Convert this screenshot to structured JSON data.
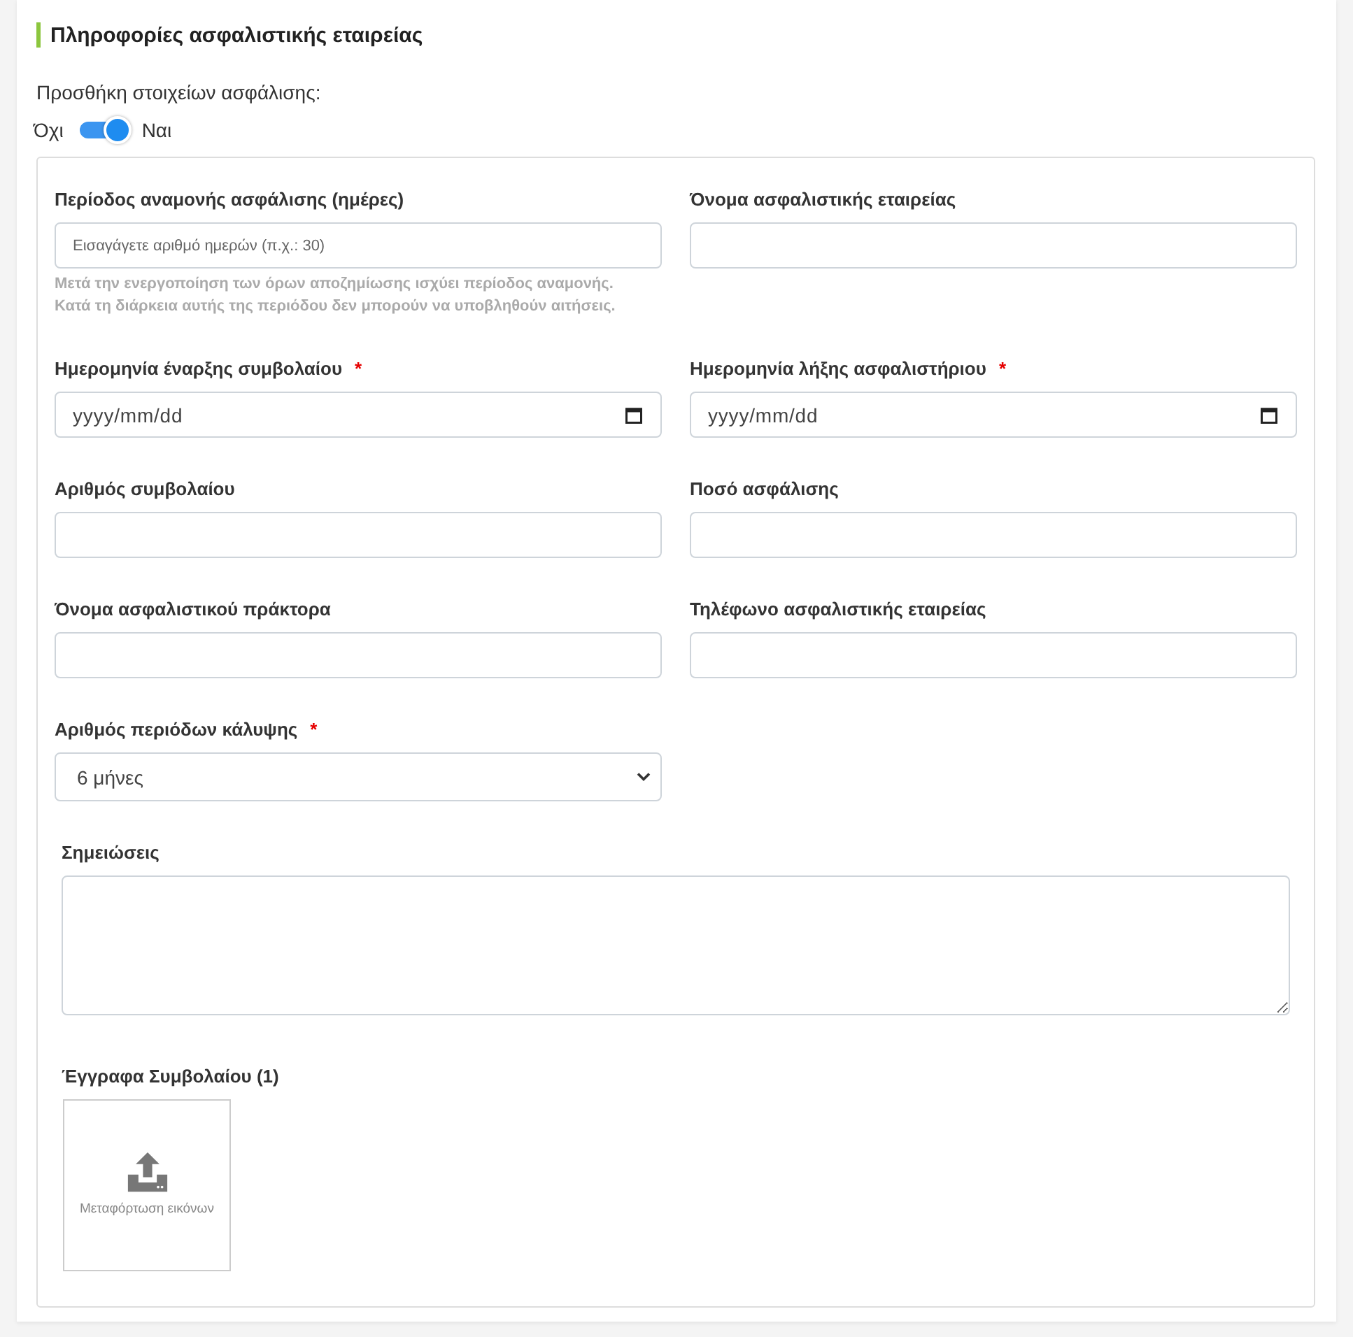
{
  "section": {
    "title": "Πληροφορίες ασφαλιστικής εταιρείας"
  },
  "insurance_toggle": {
    "question": "Προσθήκη στοιχείων ασφάλισης:",
    "off_label": "Όχι",
    "on_label": "Ναι",
    "on": true
  },
  "fields": [
    {
      "kind": "text",
      "label": "Περίοδος αναμονής ασφάλισης (ημέρες)",
      "placeholder": "Εισαγάγετε αριθμό ημερών (π.χ.: 30)",
      "help": [
        "Μετά την ενεργοποίηση των όρων αποζημίωσης ισχύει περίοδος αναμονής.",
        "Κατά τη διάρκεια αυτής της περιόδου δεν μπορούν να υποβληθούν αιτήσεις."
      ]
    },
    {
      "kind": "text",
      "label": "Όνομα ασφαλιστικής εταιρείας"
    },
    {
      "kind": "date",
      "label": "Ημερομηνία έναρξης συμβολαίου",
      "required_mark": "*",
      "placeholder": "yyyy/mm/dd"
    },
    {
      "kind": "date",
      "label": "Ημερομηνία λήξης ασφαλιστήριου",
      "required_mark": "*",
      "placeholder": "yyyy/mm/dd"
    },
    {
      "kind": "text",
      "label": "Αριθμός συμβολαίου"
    },
    {
      "kind": "text",
      "label": "Ποσό ασφάλισης"
    },
    {
      "kind": "text",
      "label": "Όνομα ασφαλιστικού πράκτορα"
    },
    {
      "kind": "text",
      "label": "Τηλέφωνο ασφαλιστικής εταιρείας"
    },
    {
      "kind": "select",
      "label": "Αριθμός περιόδων κάλυψης",
      "required_mark": "*",
      "value": "6 μήνες"
    }
  ],
  "notes": {
    "label": "Σημειώσεις"
  },
  "documents": {
    "label": "Έγγραφα Συμβολαίου (1)",
    "upload_label": "Μεταφόρτωση εικόνων"
  }
}
